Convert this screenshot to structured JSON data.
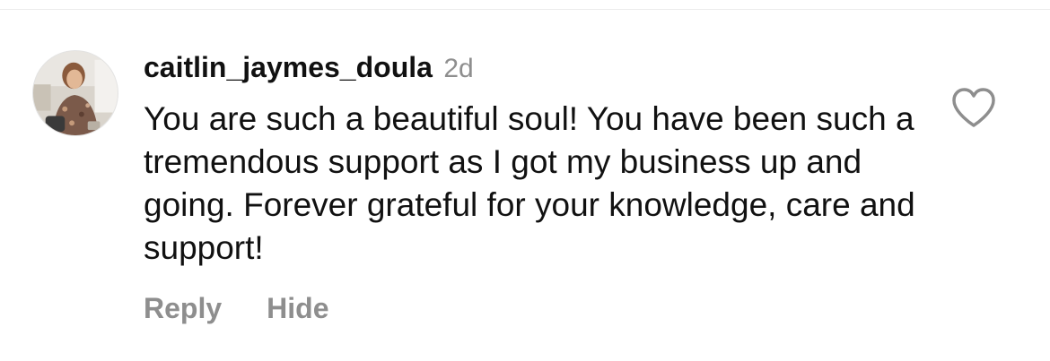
{
  "comment": {
    "username": "caitlin_jaymes_doula",
    "timestamp": "2d",
    "text": "You are such a beautiful soul! You have been such a tremendous support as I got my business up and going. Forever grateful for your knowledge, care and support!",
    "liked": false
  },
  "actions": {
    "reply_label": "Reply",
    "hide_label": "Hide"
  },
  "icons": {
    "like": "heart-outline-icon"
  },
  "colors": {
    "text_primary": "#111111",
    "text_secondary": "#8e8e8e",
    "background": "#ffffff"
  }
}
